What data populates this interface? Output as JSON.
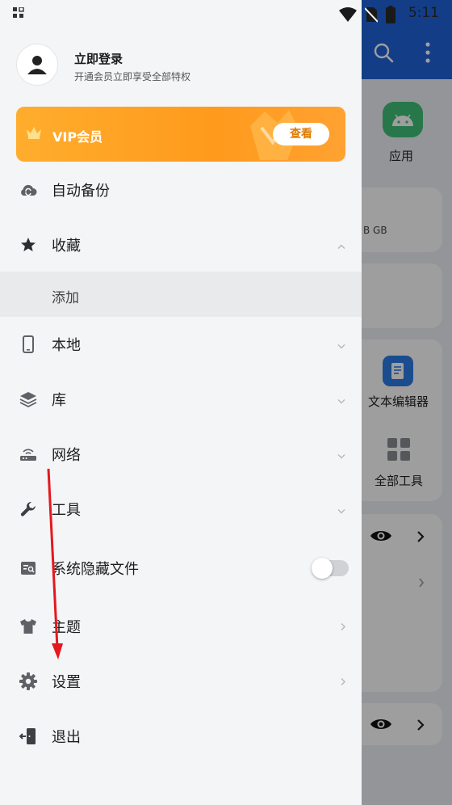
{
  "status_bar": {
    "time": "5:11"
  },
  "user": {
    "name": "立即登录",
    "subtitle": "开通会员立即享受全部特权"
  },
  "vip": {
    "label": "VIP会员",
    "button": "查看"
  },
  "menu": {
    "backup": "自动备份",
    "favorites": "收藏",
    "favorites_add": "添加",
    "local": "本地",
    "library": "库",
    "network": "网络",
    "tools": "工具",
    "hidden_files": "系统隐藏文件",
    "hidden_files_enabled": false,
    "theme": "主题",
    "settings": "设置",
    "exit": "退出"
  },
  "background": {
    "apps_label": "应用",
    "storage_fragment": "B GB",
    "text_editor": "文本编辑器",
    "all_tools": "全部工具"
  },
  "colors": {
    "brand_blue": "#1f63d8",
    "vip_orange": "#ff9f22",
    "annotation_red": "#e5181e"
  }
}
